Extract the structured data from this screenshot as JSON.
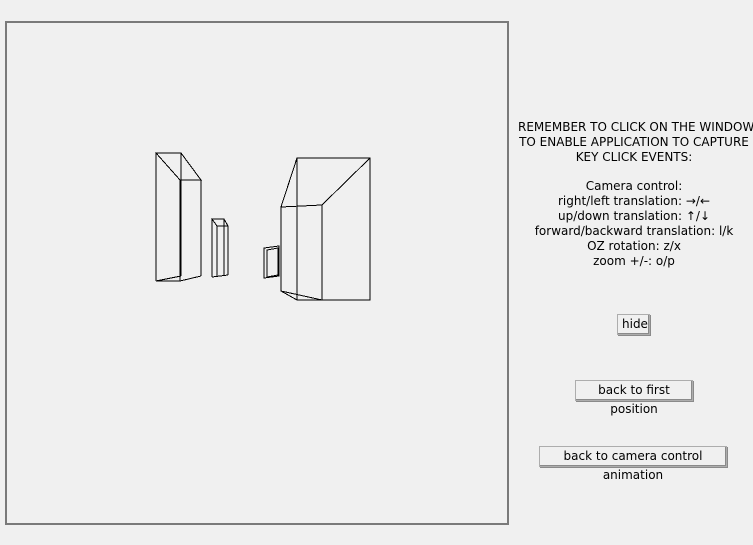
{
  "reminder": {
    "line1": "REMEMBER TO CLICK ON THE WINDOW",
    "line2": "TO ENABLE APPLICATION TO CAPTURE",
    "line3": "KEY CLICK EVENTS:"
  },
  "controls": {
    "heading": "Camera control:",
    "items": [
      "right/left translation: →/←",
      "up/down translation: ↑/↓",
      "forward/backward translation: l/k",
      "OZ rotation: z/x",
      "zoom +/-: o/p"
    ]
  },
  "buttons": {
    "hide": "hide",
    "first_position": "back to first position",
    "camera_animation": "back to camera control animation"
  },
  "scene": {
    "object_count": 4,
    "stroke_color": "#000000",
    "background_color": "#f0f0f0"
  }
}
